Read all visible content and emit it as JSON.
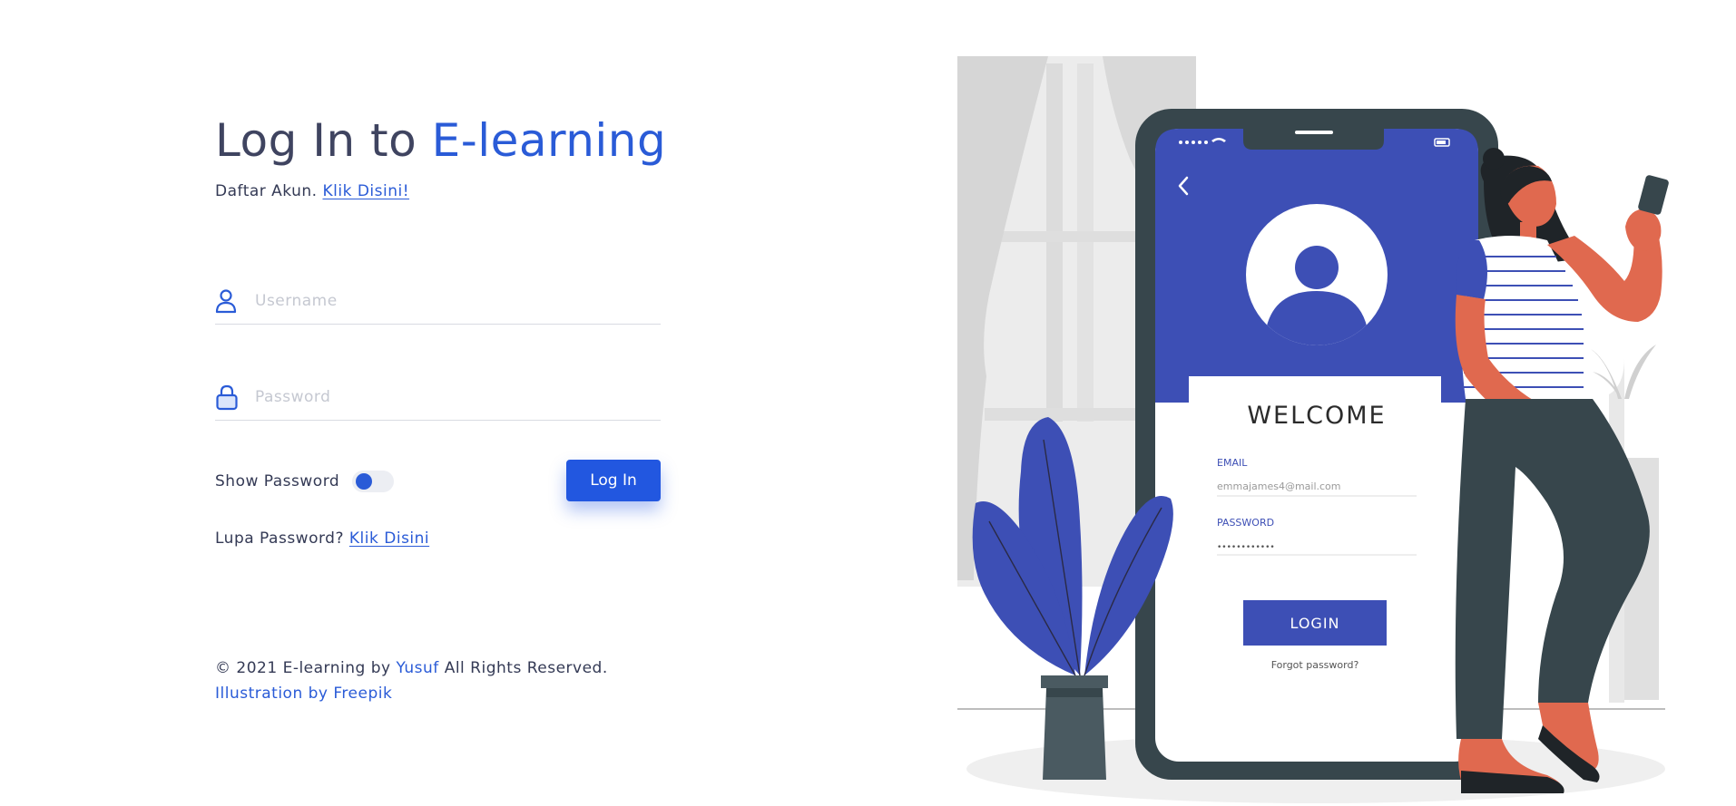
{
  "title": {
    "prefix": "Log In to ",
    "brand": "E-learning"
  },
  "register": {
    "text": "Daftar Akun. ",
    "link": "Klik Disini!"
  },
  "username": {
    "placeholder": "Username",
    "value": ""
  },
  "password": {
    "placeholder": "Password",
    "value": ""
  },
  "show_password": {
    "label": "Show Password",
    "enabled": false
  },
  "login_button": "Log In",
  "forgot": {
    "text": "Lupa Password? ",
    "link": "Klik Disini"
  },
  "footer": {
    "copyright_prefix": "© 2021 E-learning by ",
    "author": "Yusuf",
    "copyright_suffix": " All Rights Reserved.",
    "credit": "Illustration by Freepik"
  },
  "illustration": {
    "welcome": "WELCOME",
    "email_label": "EMAIL",
    "email_value": "emmajames4@mail.com",
    "password_label": "PASSWORD",
    "password_value": "••••••••••••",
    "login_label": "LOGIN",
    "forgot_label": "Forgot password?"
  },
  "colors": {
    "accent": "#2a5bd7",
    "button": "#2257e0",
    "phone_blue": "#3d4fb5",
    "phone_dark": "#37464c",
    "skin": "#e0694f"
  },
  "icons": {
    "username": "user-icon",
    "password": "lock-icon"
  }
}
